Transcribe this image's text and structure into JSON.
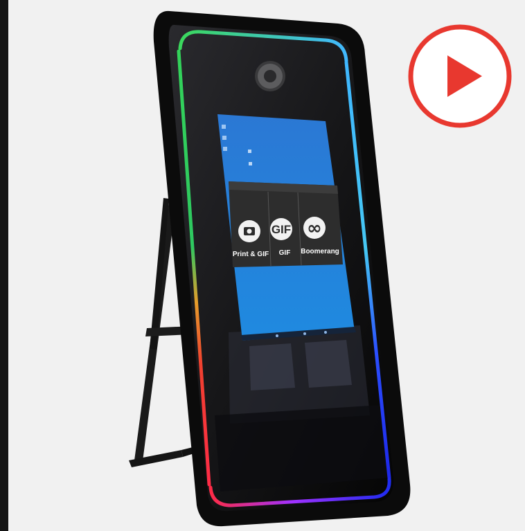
{
  "product_image": {
    "subject": "mirror photo booth kiosk",
    "play_button": {
      "icon": "play-icon",
      "color": "#e8382f"
    },
    "screen": {
      "options": [
        {
          "label": "Print & GIF",
          "icon": "camera-icon"
        },
        {
          "label": "GIF",
          "icon_text": "GIF"
        },
        {
          "label": "Boomerang",
          "icon_text": "∞"
        }
      ]
    },
    "colors": {
      "background": "#f1f1f1",
      "desktop": "#2a7fd6",
      "frame": "#0b0b0b"
    }
  }
}
